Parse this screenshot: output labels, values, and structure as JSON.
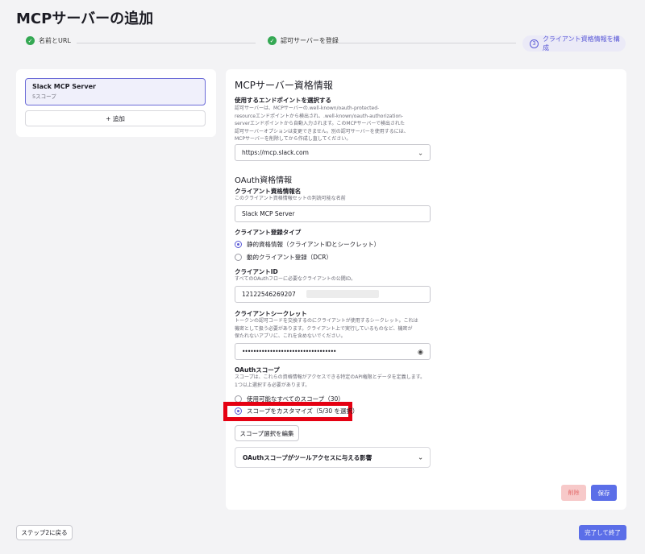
{
  "page_title": "MCPサーバーの追加",
  "steps": [
    {
      "label": "名前とURL",
      "state": "done"
    },
    {
      "label": "認可サーバーを登録",
      "state": "done"
    },
    {
      "number": "3",
      "label": "クライアント資格情報を構成",
      "state": "active"
    }
  ],
  "servers": {
    "selected": {
      "name": "Slack MCP Server",
      "subtitle": "5スコープ"
    },
    "add_label": "+ 追加"
  },
  "credentials": {
    "title": "MCPサーバー資格情報",
    "endpoint_label": "使用するエンドポイントを選択する",
    "endpoint_help": [
      "認可サーバーは、MCPサーバーの.well-known/oauth-protected-",
      "resourceエンドポイントから検出され、.well-known/oauth-authorization-",
      "serverエンドポイントから自動入力されます。このMCPサーバーで検出された",
      "認可サーバーオプションは変更できません。別の認可サーバーを使用するには、",
      "MCPサーバーを削除してから作成し直してください。"
    ],
    "endpoint_value": "https://mcp.slack.com"
  },
  "oauth": {
    "title": "OAuth資格情報",
    "name_label": "クライアント資格情報名",
    "name_help": "このクライアント資格情報セットの判読可能な名前",
    "name_value": "Slack MCP Server",
    "reg_type_label": "クライアント登録タイプ",
    "reg_options": [
      {
        "label": "静的資格情報（クライアントIDとシークレット）",
        "selected": true
      },
      {
        "label": "動的クライアント登録（DCR）",
        "selected": false
      }
    ],
    "client_id_label": "クライアントID",
    "client_id_help": "すべてのOAuthフローに必要なクライアントの公開ID。",
    "client_id_value": "12122546269207",
    "secret_label": "クライアントシークレット",
    "secret_help": [
      "トークンの認可コードを交換するのにクライアントが使用するシークレット。これは",
      "機密として扱う必要があります。クライアント上で実行しているものなど、機密が",
      "保たれないアプリに、これを含めないでください。"
    ],
    "secret_value": "••••••••••••••••••••••••••••••••••",
    "scope_label": "OAuthスコープ",
    "scope_help": [
      "スコープは、これらの資格情報がアクセスできる特定のAPI権限とデータを定義します。",
      "1つ以上選択する必要があります。"
    ],
    "scope_options": [
      {
        "label": "使用可能なすべてのスコープ（30）",
        "selected": false
      },
      {
        "label": "スコープをカスタマイズ（5/30 を選択）",
        "selected": true
      }
    ],
    "edit_scopes_label": "スコープ選択を編集",
    "impact_label": "OAuthスコープがツールアクセスに与える影響"
  },
  "actions": {
    "delete_label": "削除",
    "save_label": "保存"
  },
  "footer": {
    "back_label": "ステップ2に戻る",
    "finish_label": "完了して終了"
  },
  "colors": {
    "accent": "#5b6ee8",
    "success": "#34a853",
    "highlight": "#e50012"
  }
}
